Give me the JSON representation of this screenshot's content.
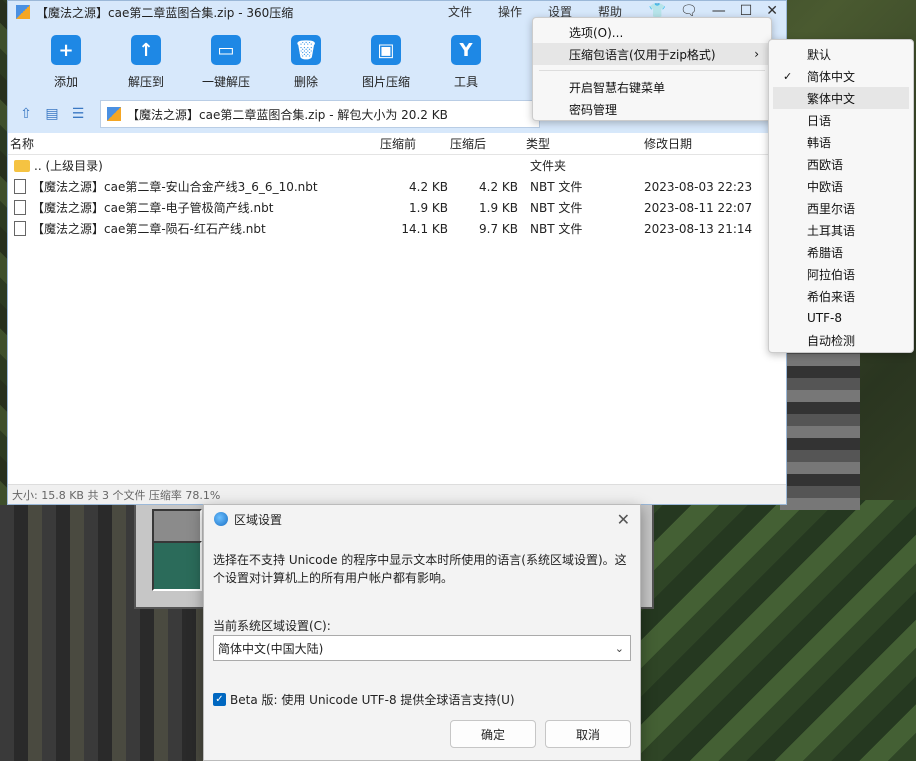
{
  "window": {
    "title": "【魔法之源】cae第二章蓝图合集.zip - 360压缩",
    "menus": [
      "文件",
      "操作",
      "设置",
      "帮助"
    ],
    "controls": [
      "👕",
      "🗨",
      "—",
      "☐",
      "✕"
    ]
  },
  "toolbar": [
    {
      "label": "添加",
      "icon": "+"
    },
    {
      "label": "解压到",
      "icon": "↑"
    },
    {
      "label": "一键解压",
      "icon": "▭"
    },
    {
      "label": "删除",
      "icon": "🗑"
    },
    {
      "label": "图片压缩",
      "icon": "▣"
    },
    {
      "label": "工具",
      "icon": "Y"
    }
  ],
  "address": {
    "path": "【魔法之源】cae第二章蓝图合集.zip - 解包大小为 20.2 KB"
  },
  "filelist": {
    "headers": {
      "name": "名称",
      "compressed": "压缩前",
      "size": "压缩后",
      "type": "类型",
      "date": "修改日期"
    },
    "parent": {
      "name": ".. (上级目录)",
      "type": "文件夹"
    },
    "files": [
      {
        "name": "【魔法之源】cae第二章-安山合金产线3_6_6_10.nbt",
        "compressed": "4.2 KB",
        "size": "4.2 KB",
        "type": "NBT 文件",
        "date": "2023-08-03 22:23"
      },
      {
        "name": "【魔法之源】cae第二章-电子管极简产线.nbt",
        "compressed": "1.9 KB",
        "size": "1.9 KB",
        "type": "NBT 文件",
        "date": "2023-08-11 22:07"
      },
      {
        "name": "【魔法之源】cae第二章-陨石-红石产线.nbt",
        "compressed": "14.1 KB",
        "size": "9.7 KB",
        "type": "NBT 文件",
        "date": "2023-08-13 21:14"
      }
    ]
  },
  "status": "大小: 15.8 KB 共 3 个文件 压缩率 78.1%",
  "settings_menu": {
    "items": [
      "选项(O)...",
      "压缩包语言(仅用于zip格式)",
      "开启智慧右键菜单",
      "密码管理"
    ],
    "submenu_arrow": "›"
  },
  "language_menu": {
    "items": [
      "默认",
      "简体中文",
      "繁体中文",
      "日语",
      "韩语",
      "西欧语",
      "中欧语",
      "西里尔语",
      "土耳其语",
      "希腊语",
      "阿拉伯语",
      "希伯来语",
      "UTF-8",
      "自动检测"
    ],
    "checked": "简体中文",
    "check_mark": "✓"
  },
  "region_dialog": {
    "title": "区域设置",
    "description": "选择在不支持 Unicode 的程序中显示文本时所使用的语言(系统区域设置)。这个设置对计算机上的所有用户帐户都有影响。",
    "current_label": "当前系统区域设置(C):",
    "current_value": "简体中文(中国大陆)",
    "beta_label": "Beta 版: 使用 Unicode UTF-8 提供全球语言支持(U)",
    "beta_checked": true,
    "ok": "确定",
    "cancel": "取消",
    "close": "✕"
  }
}
